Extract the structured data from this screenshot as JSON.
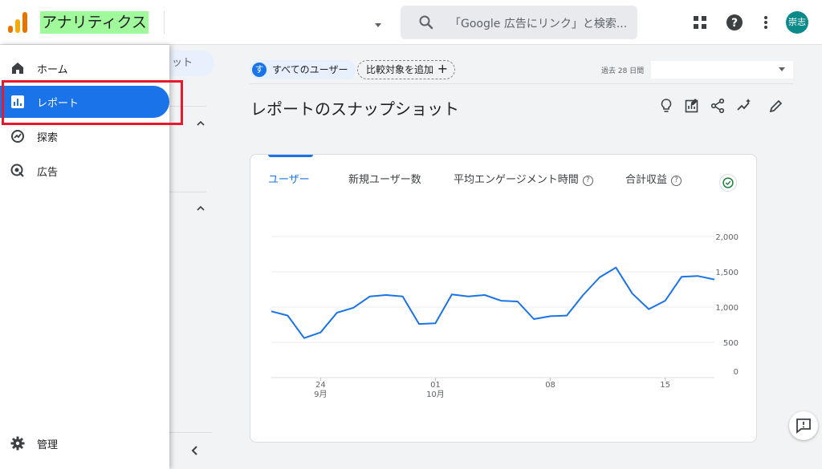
{
  "app": {
    "title": "アナリティクス"
  },
  "search": {
    "placeholder": "「Google 広告にリンク」と検索..."
  },
  "user": {
    "avatar_text": "崇志"
  },
  "subnav": {
    "pill_text": "ット"
  },
  "filters": {
    "users_badge": "す",
    "users_chip": "すべてのユーザー",
    "compare_chip": "比較対象を追加",
    "compare_plus": "+",
    "date_label": "過去 28 日間",
    "date_value": ""
  },
  "page": {
    "title": "レポートのスナップショット"
  },
  "metrics": {
    "users": "ユーザー",
    "new_users": "新規ユーザー数",
    "avg_engagement": "平均エンゲージメント時間",
    "total_revenue": "合計収益",
    "help": "?"
  },
  "drawer": {
    "items": [
      {
        "label": "ホーム",
        "icon": "home-icon"
      },
      {
        "label": "レポート",
        "icon": "reports-icon"
      },
      {
        "label": "探索",
        "icon": "explore-icon"
      },
      {
        "label": "広告",
        "icon": "advertising-icon"
      }
    ],
    "admin_label": "管理"
  },
  "colors": {
    "accent": "#1a73e8",
    "highlight": "#e8192c",
    "title_highlight": "#a0f99a",
    "avatar": "#0b8a8a"
  },
  "chart_data": {
    "type": "line",
    "x_tick_labels": [
      {
        "day": "24",
        "month": "9月"
      },
      {
        "day": "01",
        "month": "10月"
      },
      {
        "day": "08",
        "month": ""
      },
      {
        "day": "15",
        "month": ""
      }
    ],
    "y_tick_labels": [
      "2,000",
      "1,500",
      "1,000",
      "500",
      "0"
    ],
    "ylim": [
      0,
      2000
    ],
    "series": [
      {
        "values": [
          940,
          880,
          560,
          640,
          920,
          990,
          1150,
          1170,
          1150,
          760,
          770,
          1180,
          1150,
          1170,
          1090,
          1080,
          830,
          870,
          880,
          1170,
          1420,
          1560,
          1190,
          970,
          1090,
          1430,
          1440,
          1390
        ]
      }
    ]
  }
}
